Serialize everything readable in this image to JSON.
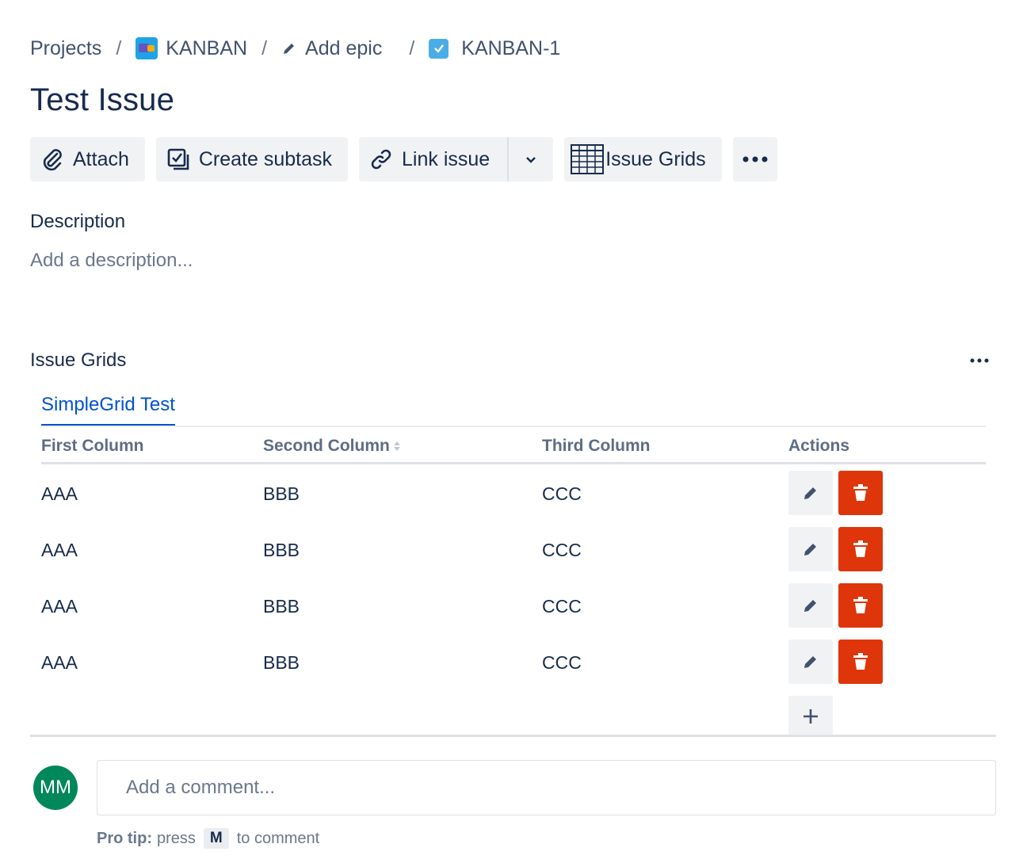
{
  "breadcrumb": {
    "projects": "Projects",
    "project": "KANBAN",
    "epic": "Add epic",
    "issue": "KANBAN-1",
    "separator": "/"
  },
  "issue": {
    "title": "Test Issue"
  },
  "toolbar": {
    "attach": "Attach",
    "create_subtask": "Create subtask",
    "link_issue": "Link issue",
    "issue_grids": "Issue Grids"
  },
  "description": {
    "label": "Description",
    "placeholder": "Add a description..."
  },
  "issue_grids": {
    "label": "Issue Grids",
    "tab": "SimpleGrid Test",
    "columns": [
      "First Column",
      "Second Column",
      "Third Column",
      "Actions"
    ],
    "rows": [
      [
        "AAA",
        "BBB",
        "CCC"
      ],
      [
        "AAA",
        "BBB",
        "CCC"
      ],
      [
        "AAA",
        "BBB",
        "CCC"
      ],
      [
        "AAA",
        "BBB",
        "CCC"
      ]
    ]
  },
  "comment": {
    "avatar_initials": "MM",
    "placeholder": "Add a comment...",
    "protip_label": "Pro tip:",
    "protip_press": "press",
    "protip_key": "M",
    "protip_suffix": "to comment"
  },
  "icons": {
    "attach": "paperclip-icon",
    "subtask": "subtask-icon",
    "link": "link-icon",
    "grid": "grid-icon",
    "edit": "pencil-icon",
    "delete": "trash-icon",
    "add": "plus-icon"
  },
  "colors": {
    "accent": "#0052cc",
    "delete": "#de350b",
    "avatar": "#00875a"
  }
}
